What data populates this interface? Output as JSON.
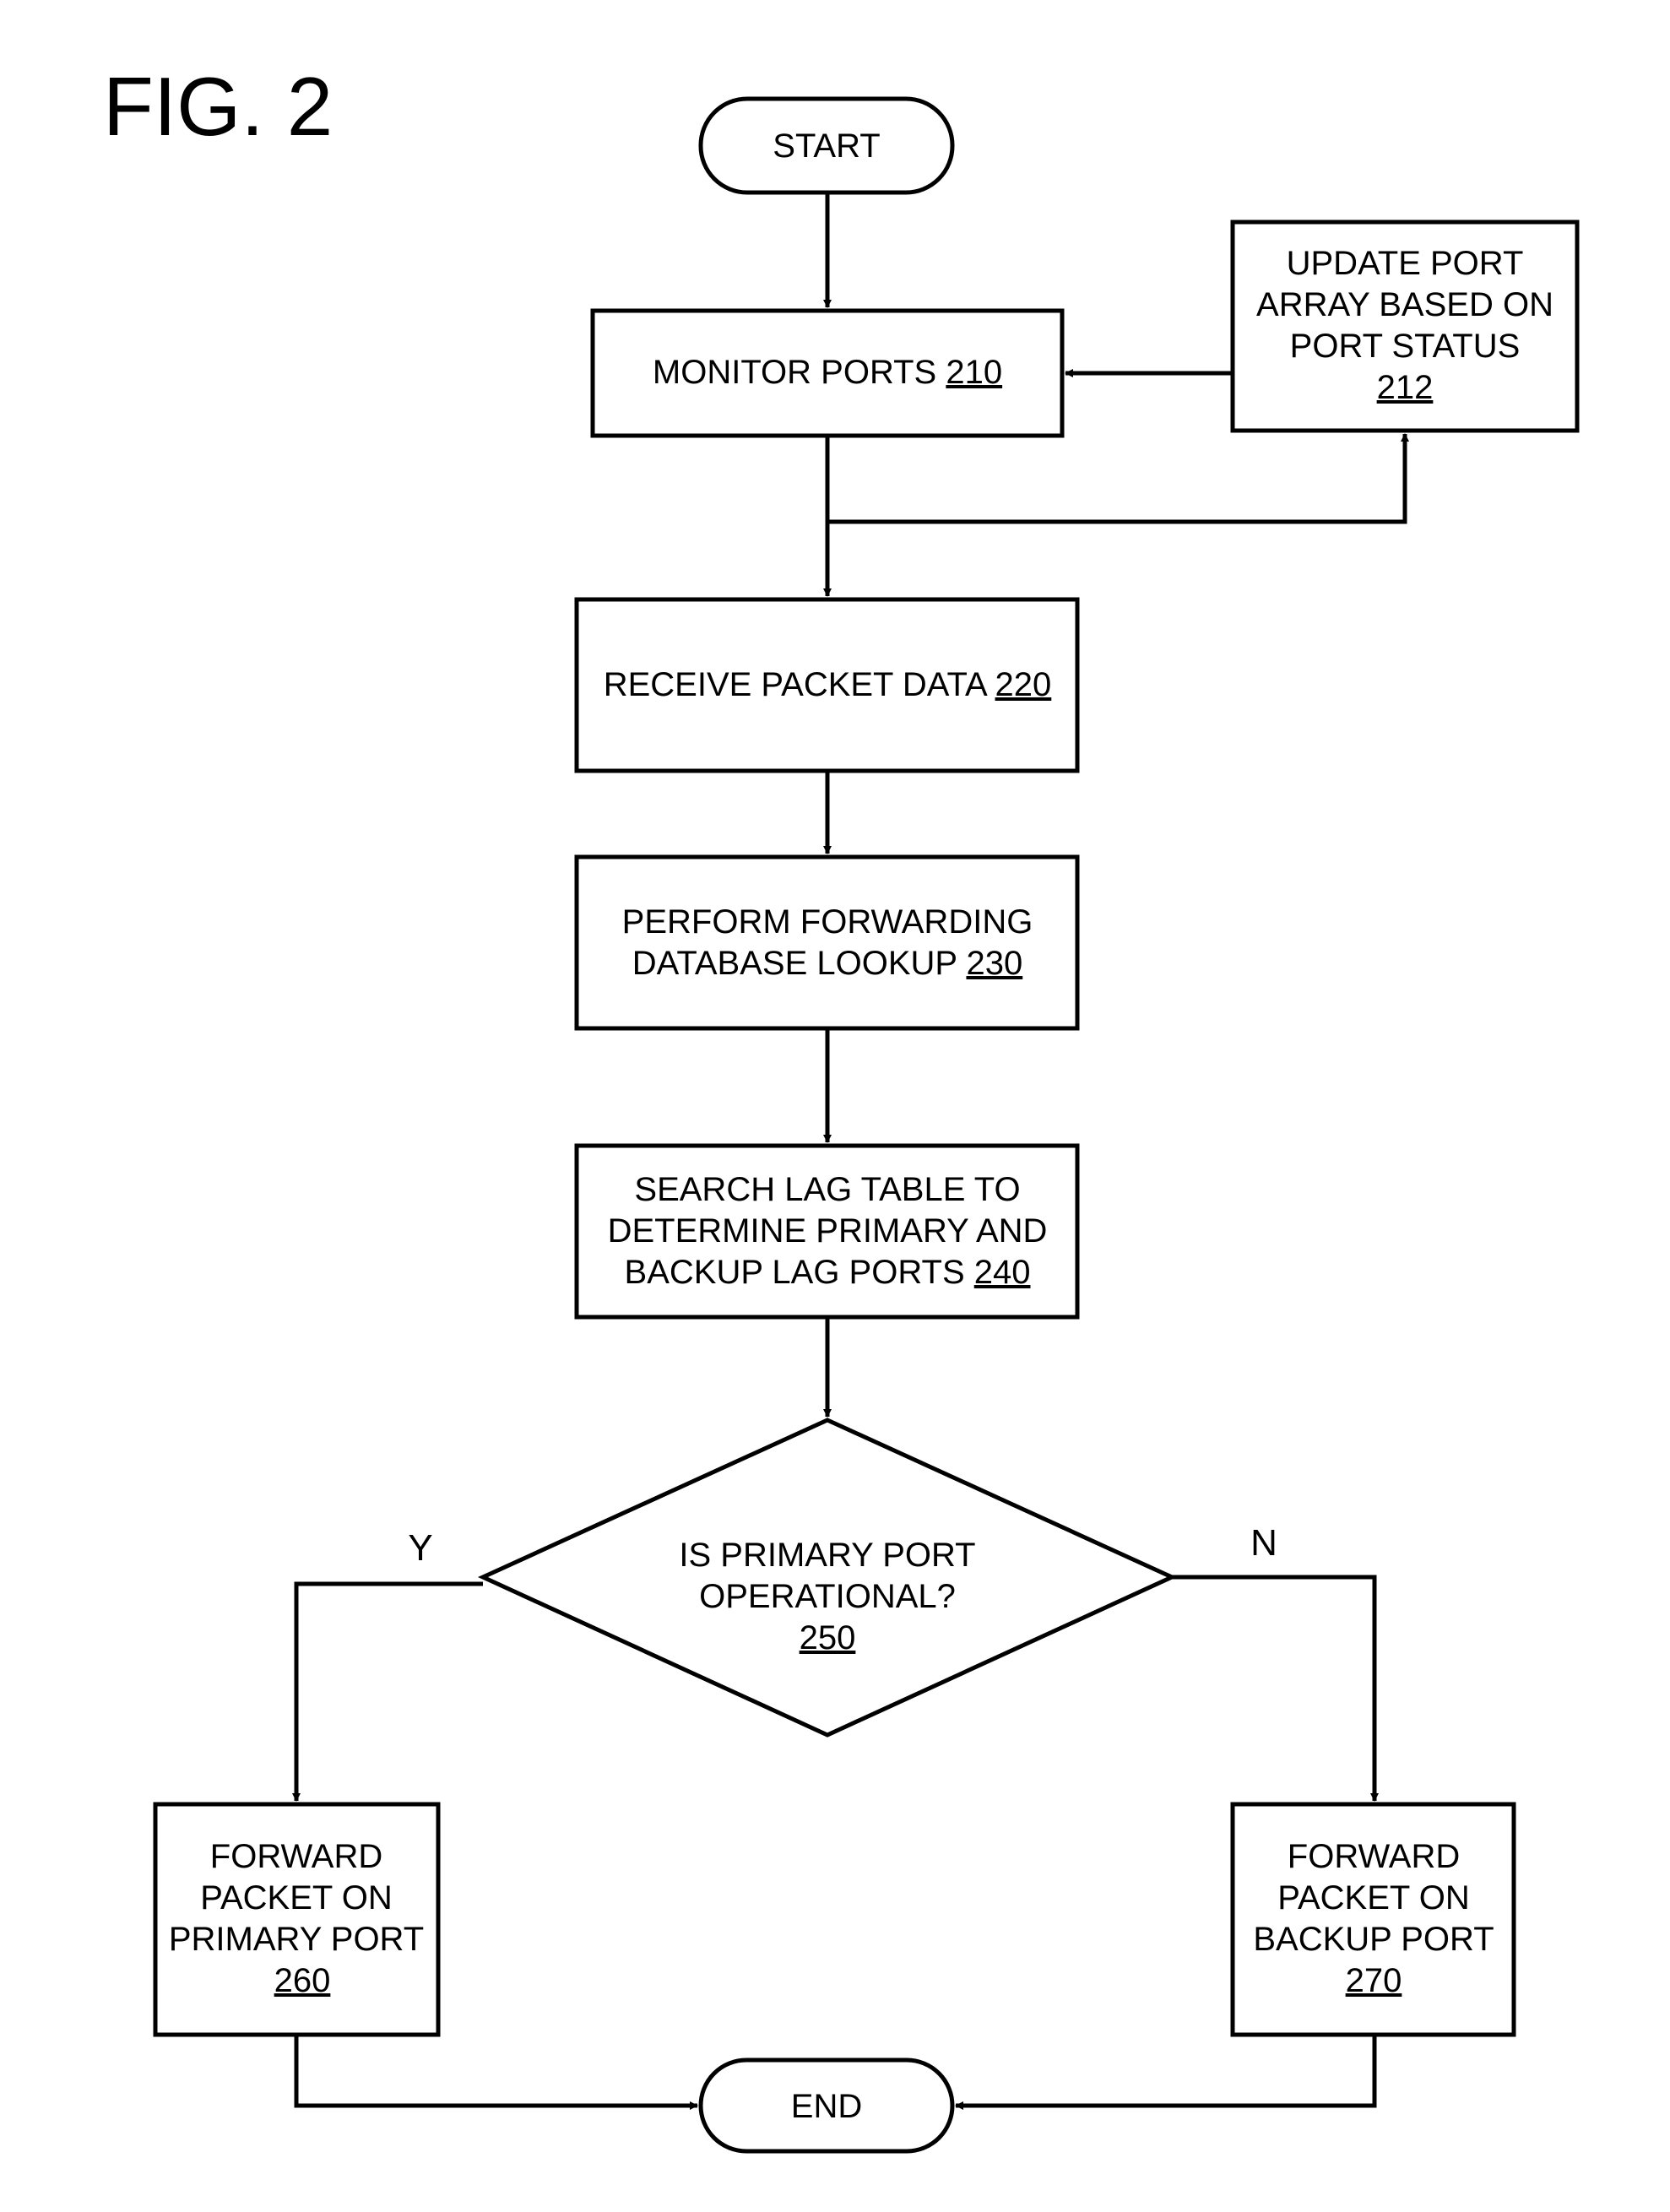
{
  "figure_label": "FIG. 2",
  "nodes": {
    "start": {
      "text": "START"
    },
    "monitor": {
      "lines": [
        "MONITOR PORTS "
      ],
      "ref": "210"
    },
    "update": {
      "lines": [
        "UPDATE PORT",
        "ARRAY BASED ON",
        "PORT STATUS"
      ],
      "ref": "212"
    },
    "receive": {
      "lines": [
        "RECEIVE PACKET DATA "
      ],
      "ref": "220"
    },
    "perform": {
      "lines": [
        "PERFORM FORWARDING",
        "DATABASE LOOKUP "
      ],
      "ref": "230"
    },
    "search": {
      "lines": [
        "SEARCH LAG TABLE TO",
        "DETERMINE PRIMARY AND",
        "BACKUP LAG PORTS "
      ],
      "ref": "240"
    },
    "decision": {
      "lines": [
        "IS PRIMARY PORT",
        "OPERATIONAL?"
      ],
      "ref": "250"
    },
    "primary": {
      "lines": [
        "FORWARD",
        "PACKET ON",
        "PRIMARY PORT"
      ],
      "ref": "260"
    },
    "backup": {
      "lines": [
        "FORWARD",
        "PACKET ON",
        "BACKUP PORT"
      ],
      "ref": "270"
    },
    "end": {
      "text": "END"
    }
  },
  "branch_labels": {
    "yes": "Y",
    "no": "N"
  }
}
